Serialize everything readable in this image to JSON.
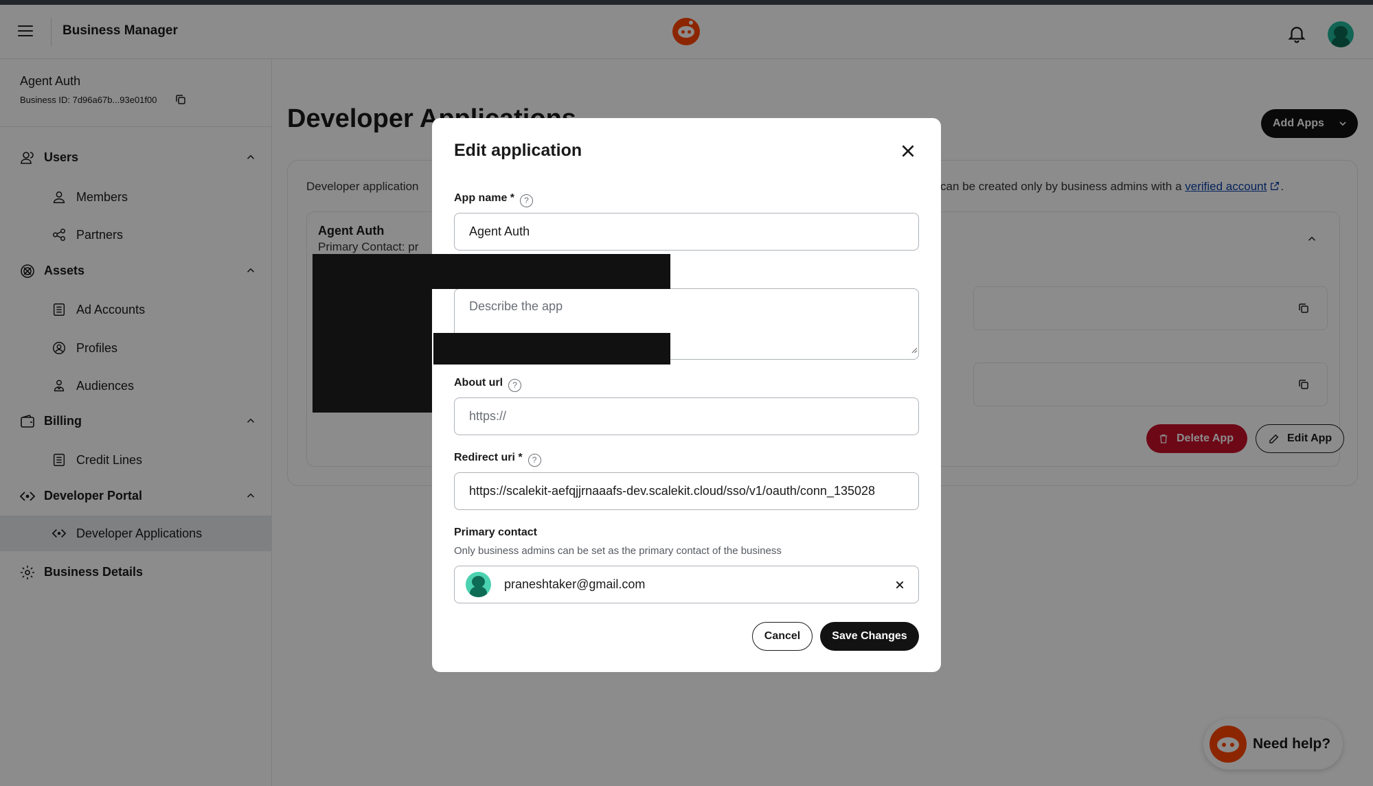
{
  "header": {
    "title": "Business Manager",
    "logo_icon": "reddit-logo-icon",
    "notifications_icon": "bell-icon"
  },
  "sidebar": {
    "business_name": "Agent Auth",
    "business_id": "Business ID: 7d96a67b...93e01f00",
    "sections": {
      "users": {
        "label": "Users",
        "items": [
          "Members",
          "Partners"
        ]
      },
      "assets": {
        "label": "Assets",
        "items": [
          "Ad Accounts",
          "Profiles",
          "Audiences"
        ]
      },
      "billing": {
        "label": "Billing",
        "items": [
          "Credit Lines"
        ]
      },
      "developer_portal": {
        "label": "Developer Portal",
        "items": [
          "Developer Applications"
        ]
      },
      "business_details": {
        "label": "Business Details"
      }
    },
    "active_item": "Developer Applications"
  },
  "main": {
    "title": "Developer Applications",
    "add_apps_label": "Add Apps",
    "description_left": "Developer application",
    "description_right": "can be created only by business admins with a",
    "verified_link": "verified account",
    "card": {
      "title": "Agent Auth",
      "contact": "Primary Contact: pr",
      "delete_label": "Delete App",
      "edit_label": "Edit App"
    }
  },
  "modal": {
    "title": "Edit application",
    "app_name_label": "App name *",
    "app_name_value": "Agent Auth",
    "description_placeholder": "Describe the app",
    "about_url_label": "About url",
    "about_url_placeholder": "https://",
    "redirect_uri_label": "Redirect uri *",
    "redirect_uri_value": "https://scalekit-aefqjjrnaaafs-dev.scalekit.cloud/sso/v1/oauth/conn_135028",
    "primary_contact_label": "Primary contact",
    "primary_contact_hint": "Only business admins can be set as the primary contact of the business",
    "primary_contact_value": "praneshtaker@gmail.com",
    "cancel_label": "Cancel",
    "save_label": "Save Changes"
  },
  "help": {
    "label": "Need help?"
  },
  "colors": {
    "brand": "#ff4500",
    "primary_button": "#121212",
    "danger": "#c7102b",
    "link": "#0a3fa6",
    "avatar": "#22b89a"
  }
}
